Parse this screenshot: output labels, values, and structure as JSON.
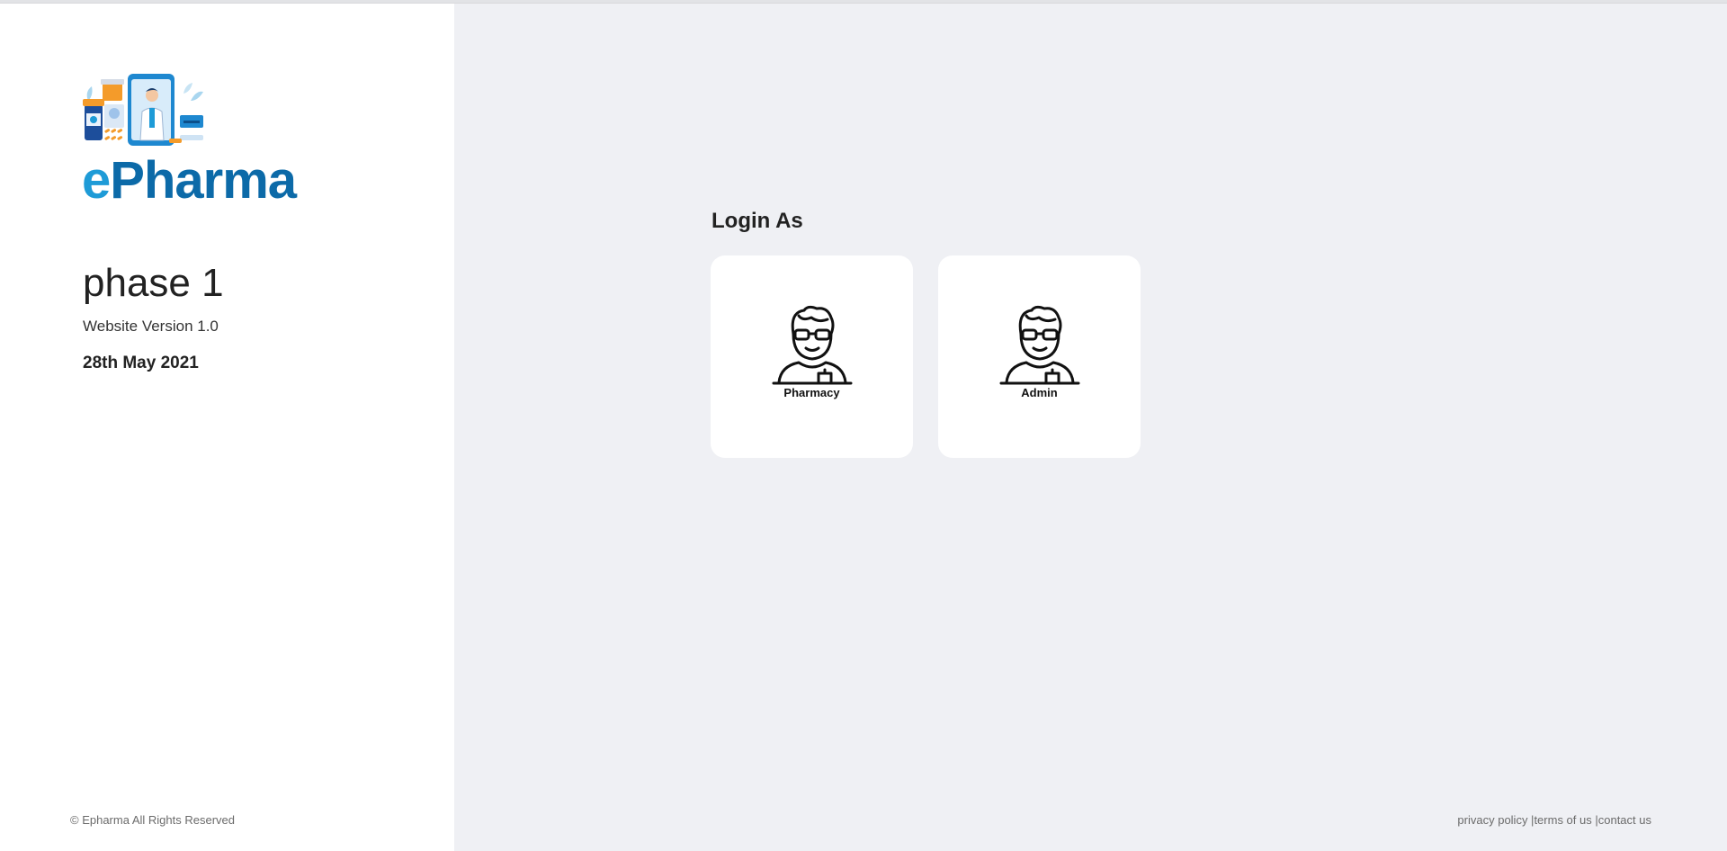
{
  "brand": {
    "name_e": "e",
    "name_rest": "Pharma",
    "colors": {
      "e": "#1e9bd7",
      "rest": "#0c6aa8"
    }
  },
  "release": {
    "phase": "phase 1",
    "version": "Website Version 1.0",
    "date": "28th May 2021"
  },
  "footer": {
    "copyright": "© Epharma All Rights Reserved",
    "links": [
      "privacy policy |",
      "terms of us |",
      "contact us"
    ]
  },
  "login": {
    "title": "Login As",
    "options": [
      {
        "label": "Pharmacy",
        "icon": "pharmacist-avatar-icon"
      },
      {
        "label": "Admin",
        "icon": "admin-avatar-icon"
      }
    ]
  },
  "colors": {
    "panel_left": "#ffffff",
    "panel_right": "#eff0f4",
    "card": "#ffffff"
  }
}
